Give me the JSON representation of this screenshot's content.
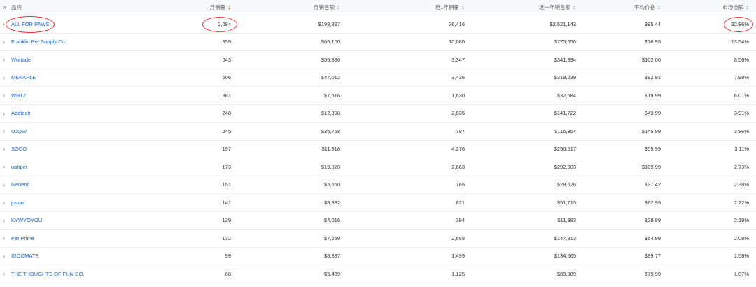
{
  "header": {
    "hash": "#",
    "brand": "品牌",
    "monthly_sales": "月销量",
    "monthly_revenue": "月销售额",
    "yearly_sales": "近1年销量",
    "yearly_revenue": "近一年销售额",
    "avg_price": "平均价格",
    "market_share": "市场份额"
  },
  "rows": [
    {
      "brand": "ALL FOR PAWS",
      "monthly_sales": "2,084",
      "monthly_revenue": "$198,897",
      "yearly_sales": "26,416",
      "yearly_revenue": "$2,521,143",
      "avg_price": "$95.44",
      "market_share": "32.86%"
    },
    {
      "brand": "Franklin Pet Supply Co.",
      "monthly_sales": "859",
      "monthly_revenue": "$66,100",
      "yearly_sales": "10,080",
      "yearly_revenue": "$775,656",
      "avg_price": "$76.95",
      "market_share": "13.54%"
    },
    {
      "brand": "Wortade",
      "monthly_sales": "543",
      "monthly_revenue": "$55,386",
      "yearly_sales": "3,347",
      "yearly_revenue": "$341,394",
      "avg_price": "$102.00",
      "market_share": "8.56%"
    },
    {
      "brand": "MEKAPLE",
      "monthly_sales": "506",
      "monthly_revenue": "$47,012",
      "yearly_sales": "3,436",
      "yearly_revenue": "$319,239",
      "avg_price": "$92.91",
      "market_share": "7.98%"
    },
    {
      "brand": "WRTZ",
      "monthly_sales": "381",
      "monthly_revenue": "$7,616",
      "yearly_sales": "1,630",
      "yearly_revenue": "$32,584",
      "avg_price": "$19.99",
      "market_share": "6.01%"
    },
    {
      "brand": "Abdtech",
      "monthly_sales": "248",
      "monthly_revenue": "$12,398",
      "yearly_sales": "2,835",
      "yearly_revenue": "$141,722",
      "avg_price": "$49.99",
      "market_share": "3.91%"
    },
    {
      "brand": "UJQW",
      "monthly_sales": "245",
      "monthly_revenue": "$35,768",
      "yearly_sales": "797",
      "yearly_revenue": "$116,354",
      "avg_price": "$145.99",
      "market_share": "3.86%"
    },
    {
      "brand": "SOCO",
      "monthly_sales": "197",
      "monthly_revenue": "$11,818",
      "yearly_sales": "4,276",
      "yearly_revenue": "$256,517",
      "avg_price": "$59.99",
      "market_share": "3.11%"
    },
    {
      "brand": "uahpet",
      "monthly_sales": "173",
      "monthly_revenue": "$19,028",
      "yearly_sales": "2,663",
      "yearly_revenue": "$292,903",
      "avg_price": "$109.99",
      "market_share": "2.73%"
    },
    {
      "brand": "Generic",
      "monthly_sales": "151",
      "monthly_revenue": "$5,650",
      "yearly_sales": "765",
      "yearly_revenue": "$28,626",
      "avg_price": "$37.42",
      "market_share": "2.38%"
    },
    {
      "brand": "jovani",
      "monthly_sales": "141",
      "monthly_revenue": "$8,882",
      "yearly_sales": "821",
      "yearly_revenue": "$51,715",
      "avg_price": "$62.99",
      "market_share": "2.22%"
    },
    {
      "brand": "KYWYOYOU",
      "monthly_sales": "139",
      "monthly_revenue": "$4,016",
      "yearly_sales": "394",
      "yearly_revenue": "$11,383",
      "avg_price": "$28.89",
      "market_share": "2.19%"
    },
    {
      "brand": "Pet Prime",
      "monthly_sales": "132",
      "monthly_revenue": "$7,259",
      "yearly_sales": "2,688",
      "yearly_revenue": "$147,813",
      "avg_price": "$54.99",
      "market_share": "2.08%"
    },
    {
      "brand": "IDOGMATE",
      "monthly_sales": "99",
      "monthly_revenue": "$8,887",
      "yearly_sales": "1,499",
      "yearly_revenue": "$134,565",
      "avg_price": "$89.77",
      "market_share": "1.56%"
    },
    {
      "brand": "THE THOUGHTS OF FUN CO.",
      "monthly_sales": "68",
      "monthly_revenue": "$5,439",
      "yearly_sales": "1,125",
      "yearly_revenue": "$89,989",
      "avg_price": "$79.99",
      "market_share": "1.07%"
    }
  ],
  "colors": {
    "link": "#1a66c9",
    "sort_active": "#f28c28",
    "annotation_circle": "#e23232"
  },
  "icons": {
    "expand": "chevron-right-icon",
    "sort": "sort-icon"
  }
}
